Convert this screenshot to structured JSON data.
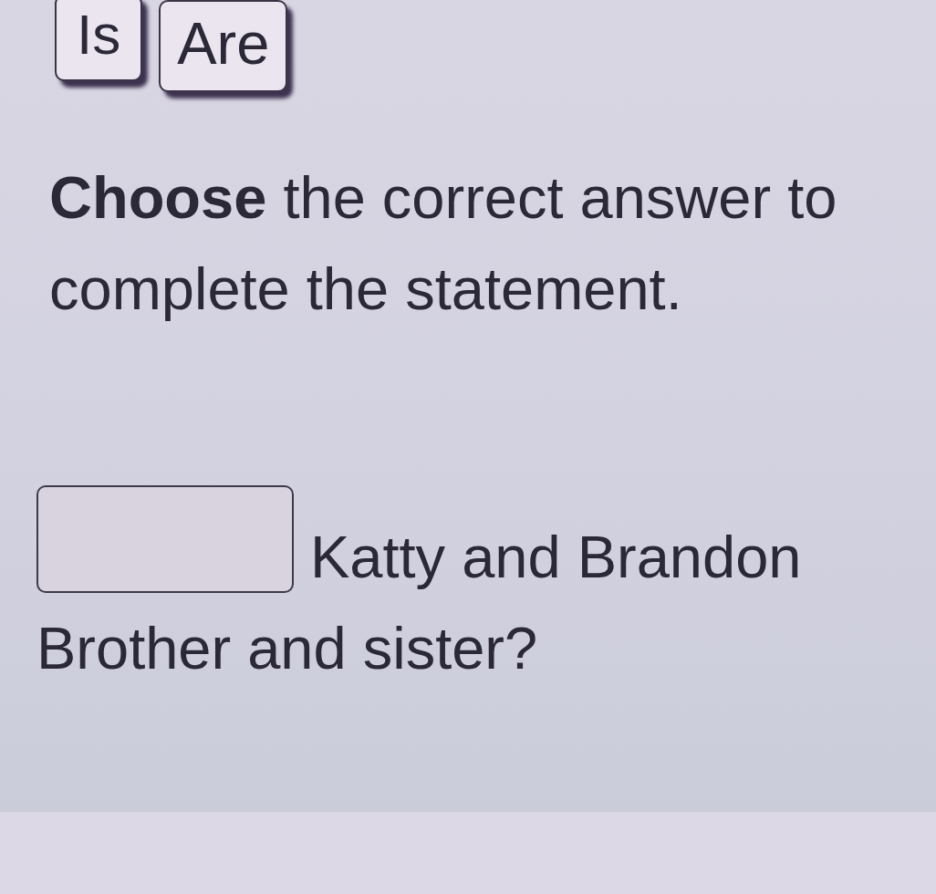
{
  "choices": [
    {
      "label": "Is"
    },
    {
      "label": "Are"
    }
  ],
  "instruction": "**Choose** the correct answer to complete the statement.",
  "statement": [
    {
      "kind": "blank"
    },
    {
      "kind": "text",
      "text": "Katty and Brandon"
    },
    {
      "kind": "text",
      "text": "Brother and sister?"
    }
  ]
}
